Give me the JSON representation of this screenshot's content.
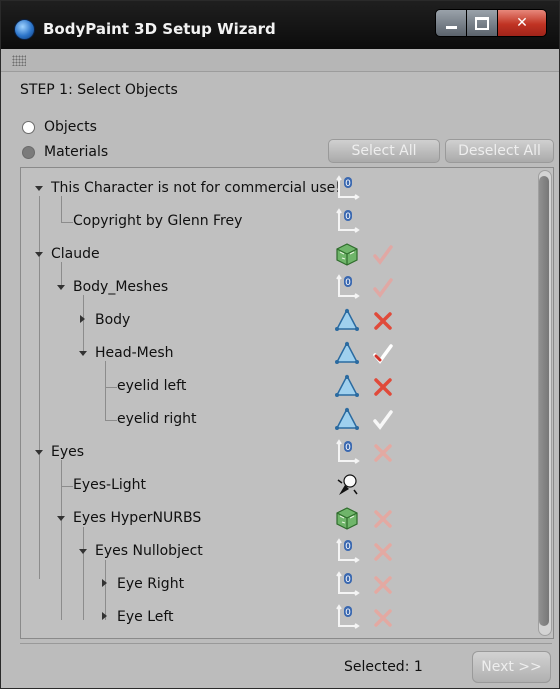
{
  "window": {
    "title": "BodyPaint 3D Setup Wizard"
  },
  "step": {
    "title": "STEP 1: Select Objects"
  },
  "mode": {
    "options": [
      {
        "label": "Objects",
        "selected": true
      },
      {
        "label": "Materials",
        "selected": false
      }
    ]
  },
  "buttons": {
    "select_all": "Select All",
    "deselect_all": "Deselect All",
    "next": "Next >>"
  },
  "tree": {
    "rows": [
      {
        "label": "This Character is not for commercial use!",
        "expander": "down",
        "icon": "null-object-icon",
        "check": "none"
      },
      {
        "label": "Copyright by Glenn Frey",
        "expander": "none",
        "icon": "null-object-icon",
        "check": "none"
      },
      {
        "label": "Claude",
        "expander": "down",
        "icon": "hypernurbs-icon",
        "check": "check-faded"
      },
      {
        "label": "Body_Meshes",
        "expander": "down",
        "icon": "null-object-icon",
        "check": "check-faded"
      },
      {
        "label": "Body",
        "expander": "right",
        "icon": "polygon-object-icon",
        "check": "cross"
      },
      {
        "label": "Head-Mesh",
        "expander": "down",
        "icon": "polygon-object-icon",
        "check": "check-red"
      },
      {
        "label": "eyelid left",
        "expander": "none",
        "icon": "polygon-object-icon",
        "check": "cross"
      },
      {
        "label": "eyelid right",
        "expander": "none",
        "icon": "polygon-object-icon",
        "check": "check-white"
      },
      {
        "label": "Eyes",
        "expander": "down",
        "icon": "null-object-icon",
        "check": "cross-faded"
      },
      {
        "label": "Eyes-Light",
        "expander": "none",
        "icon": "light-icon",
        "check": "none"
      },
      {
        "label": "Eyes HyperNURBS",
        "expander": "down",
        "icon": "hypernurbs-icon",
        "check": "cross-faded"
      },
      {
        "label": "Eyes Nullobject",
        "expander": "down",
        "icon": "null-object-icon",
        "check": "cross-faded"
      },
      {
        "label": "Eye Right",
        "expander": "right",
        "icon": "null-object-icon",
        "check": "cross-faded"
      },
      {
        "label": "Eye Left",
        "expander": "right",
        "icon": "null-object-icon",
        "check": "cross-faded"
      }
    ]
  },
  "footer": {
    "selected_label": "Selected: 1"
  }
}
